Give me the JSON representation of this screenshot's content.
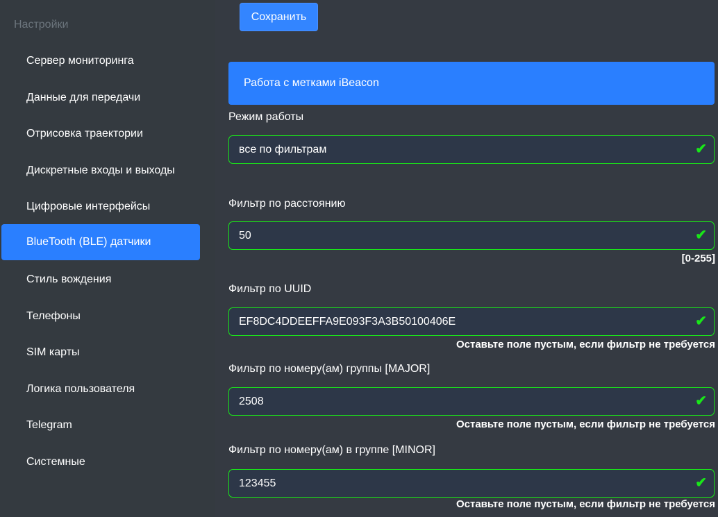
{
  "sidebar": {
    "title": "Настройки",
    "items": [
      "Сервер мониторинга",
      "Данные для передачи",
      "Отрисовка траектории",
      "Дискретные входы и выходы",
      "Цифровые интерфейсы",
      "BlueTooth (BLE) датчики",
      "Стиль вождения",
      "Телефоны",
      "SIM карты",
      "Логика пользователя",
      "Telegram",
      "Системные"
    ],
    "active_index": 5
  },
  "toolbar": {
    "save_label": "Сохранить"
  },
  "section": {
    "title": "Работа с метками iBeacon"
  },
  "fields": [
    {
      "label": "Режим работы",
      "value": "все по фильтрам",
      "hint": ""
    },
    {
      "label": "Фильтр по расстоянию",
      "value": "50",
      "hint": "[0-255]"
    },
    {
      "label": "Фильтр по UUID",
      "value": "EF8DC4DDEEFFA9E093F3A3B50100406E",
      "hint": "Оставьте поле пустым, если фильтр не требуется"
    },
    {
      "label": "Фильтр по номеру(ам) группы [MAJOR]",
      "value": "2508",
      "hint": "Оставьте поле пустым, если фильтр не требуется"
    },
    {
      "label": "Фильтр по номеру(ам) в группе [MINOR]",
      "value": "123455",
      "hint": "Оставьте поле пустым, если фильтр не требуется"
    }
  ],
  "check_glyph": "✔"
}
